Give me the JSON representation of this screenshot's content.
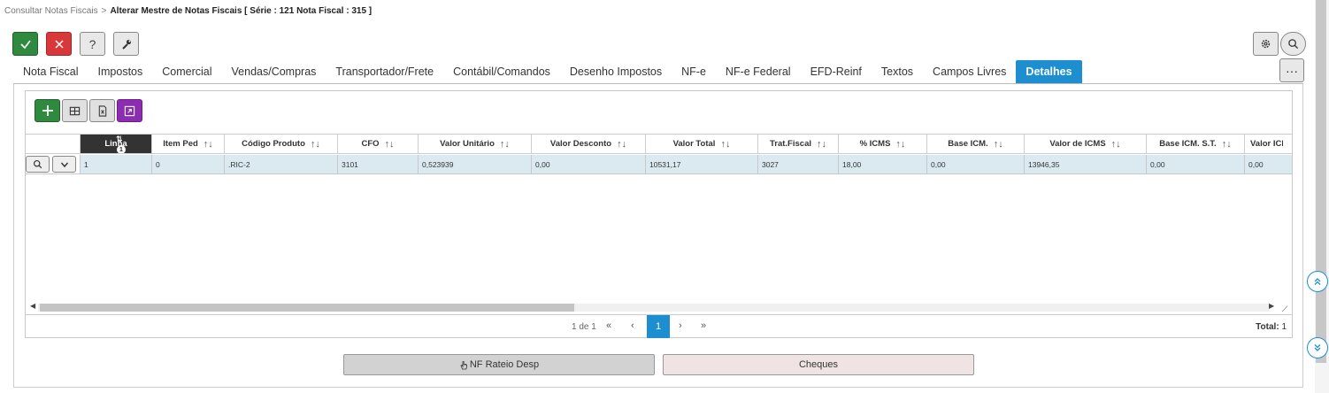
{
  "breadcrumb": {
    "parent": "Consultar Notas Fiscais",
    "separator": ">",
    "current": "Alterar Mestre de Notas Fiscais [ Série : 121 Nota Fiscal : 315 ]"
  },
  "toolbar": {
    "confirm_icon": "check-icon",
    "cancel_icon": "close-icon",
    "help_label": "?",
    "tools_icon": "wrench-icon",
    "settings_icon": "gear-icon",
    "search_icon": "search-icon"
  },
  "tabs": [
    {
      "label": "Nota Fiscal"
    },
    {
      "label": "Impostos"
    },
    {
      "label": "Comercial"
    },
    {
      "label": "Vendas/Compras"
    },
    {
      "label": "Transportador/Frete"
    },
    {
      "label": "Contábil/Comandos"
    },
    {
      "label": "Desenho Impostos"
    },
    {
      "label": "NF-e"
    },
    {
      "label": "NF-e Federal"
    },
    {
      "label": "EFD-Reinf"
    },
    {
      "label": "Textos"
    },
    {
      "label": "Campos Livres"
    },
    {
      "label": "Detalhes",
      "active": true
    }
  ],
  "more_label": "···",
  "grid": {
    "toolbar_icons": [
      "add-icon",
      "columns-icon",
      "excel-icon",
      "expand-icon"
    ],
    "columns": [
      {
        "label": "Linha",
        "sorted": true,
        "sort_badge": "1"
      },
      {
        "label": "Item Ped"
      },
      {
        "label": "Código Produto"
      },
      {
        "label": "CFO"
      },
      {
        "label": "Valor Unitário"
      },
      {
        "label": "Valor Desconto"
      },
      {
        "label": "Valor Total"
      },
      {
        "label": "Trat.Fiscal"
      },
      {
        "label": "% ICMS"
      },
      {
        "label": "Base ICM."
      },
      {
        "label": "Valor de ICMS"
      },
      {
        "label": "Base ICM. S.T."
      },
      {
        "label": "Valor ICMS"
      }
    ],
    "sort_glyph": "↑↓",
    "rows": [
      [
        "1",
        "0",
        ".RIC-2",
        "3101",
        "0,523939",
        "0,00",
        "10531,17",
        "3027",
        "18,00",
        "0,00",
        "13946,35",
        "0,00",
        "0,00"
      ]
    ]
  },
  "pager": {
    "info": "1 de 1",
    "first": "«",
    "prev": "‹",
    "current_page": "1",
    "next": "›",
    "last": "»",
    "total_label": "Total:",
    "total_value": "1"
  },
  "buttons": {
    "rateio": "NF Rateio Desp",
    "cheques": "Cheques"
  },
  "colors": {
    "accent": "#1d8fd0",
    "confirm": "#2f8a3f",
    "cancel": "#d9383a",
    "expand": "#8e2bb3",
    "row_selected": "#dbeaf0"
  }
}
